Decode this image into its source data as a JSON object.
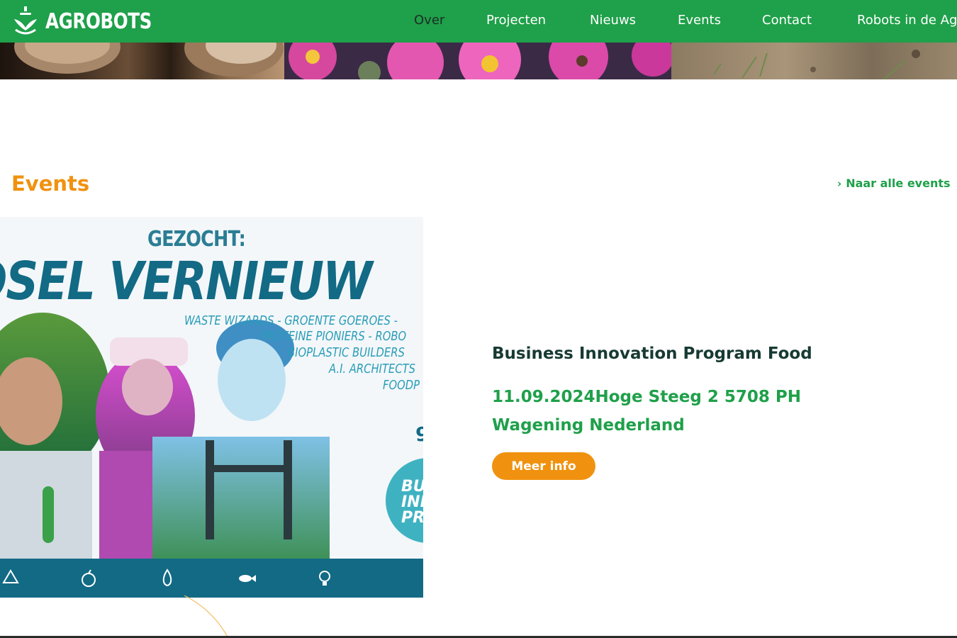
{
  "header": {
    "brand": "AGROBOTS",
    "nav": [
      {
        "label": "Over",
        "active": true
      },
      {
        "label": "Projecten",
        "active": false
      },
      {
        "label": "Nieuws",
        "active": false
      },
      {
        "label": "Events",
        "active": false
      },
      {
        "label": "Contact",
        "active": false
      },
      {
        "label": "Robots in de Ag",
        "active": false
      }
    ]
  },
  "events_section": {
    "title": "Events",
    "all_events_link": "Naar alle events",
    "poster": {
      "kicker": "GEZOCHT:",
      "headline": "OSEL VERNIEUW",
      "lines": [
        "WASTE WIZARDS - GROENTE GOEROES -",
        "PROTEINE PIONIERS - ROBO",
        "BIOPLASTIC BUILDERS",
        "A.I. ARCHITECTS",
        "FOODP"
      ],
      "badge_lines": [
        "BU",
        "INI",
        "PR"
      ],
      "digit": "9"
    },
    "event": {
      "title": "Business Innovation Program Food",
      "meta": "11.09.2024Hoge Steeg 2 5708 PH Wagening Nederland",
      "button": "Meer info"
    }
  },
  "colors": {
    "brand_green": "#1fa04a",
    "accent_orange": "#f0920f",
    "title_dark": "#173a33",
    "poster_blue": "#126a85"
  }
}
